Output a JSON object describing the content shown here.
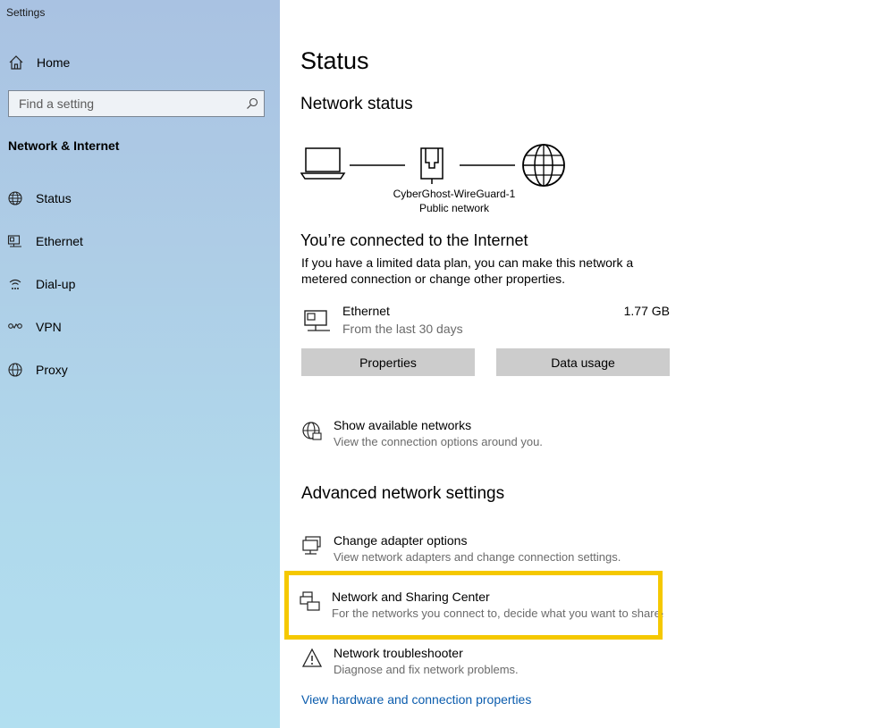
{
  "app": {
    "title": "Settings"
  },
  "sidebar": {
    "home_label": "Home",
    "search_placeholder": "Find a setting",
    "section_title": "Network & Internet",
    "items": [
      {
        "label": "Status",
        "icon": "globe-icon"
      },
      {
        "label": "Ethernet",
        "icon": "ethernet-icon"
      },
      {
        "label": "Dial-up",
        "icon": "dialup-icon"
      },
      {
        "label": "VPN",
        "icon": "vpn-icon"
      },
      {
        "label": "Proxy",
        "icon": "proxy-globe-icon"
      }
    ]
  },
  "main": {
    "title": "Status",
    "network_status_heading": "Network status",
    "diagram": {
      "network_name": "CyberGhost-WireGuard-1",
      "network_type": "Public network"
    },
    "connected_heading": "You’re connected to the Internet",
    "connected_desc": "If you have a limited data plan, you can make this network a metered connection or change other properties.",
    "ethernet": {
      "name": "Ethernet",
      "sub": "From the last 30 days",
      "usage": "1.77 GB"
    },
    "buttons": {
      "properties": "Properties",
      "data_usage": "Data usage"
    },
    "show_networks": {
      "title": "Show available networks",
      "sub": "View the connection options around you."
    },
    "advanced_heading": "Advanced network settings",
    "adapter_options": {
      "title": "Change adapter options",
      "sub": "View network adapters and change connection settings."
    },
    "sharing_center": {
      "title": "Network and Sharing Center",
      "sub": "For the networks you connect to, decide what you want to share."
    },
    "troubleshooter": {
      "title": "Network troubleshooter",
      "sub": "Diagnose and fix network problems."
    },
    "hardware_link": "View hardware and connection properties"
  },
  "colors": {
    "highlight": "#f5c800",
    "link": "#0b5cad",
    "button_bg": "#cccccc"
  }
}
